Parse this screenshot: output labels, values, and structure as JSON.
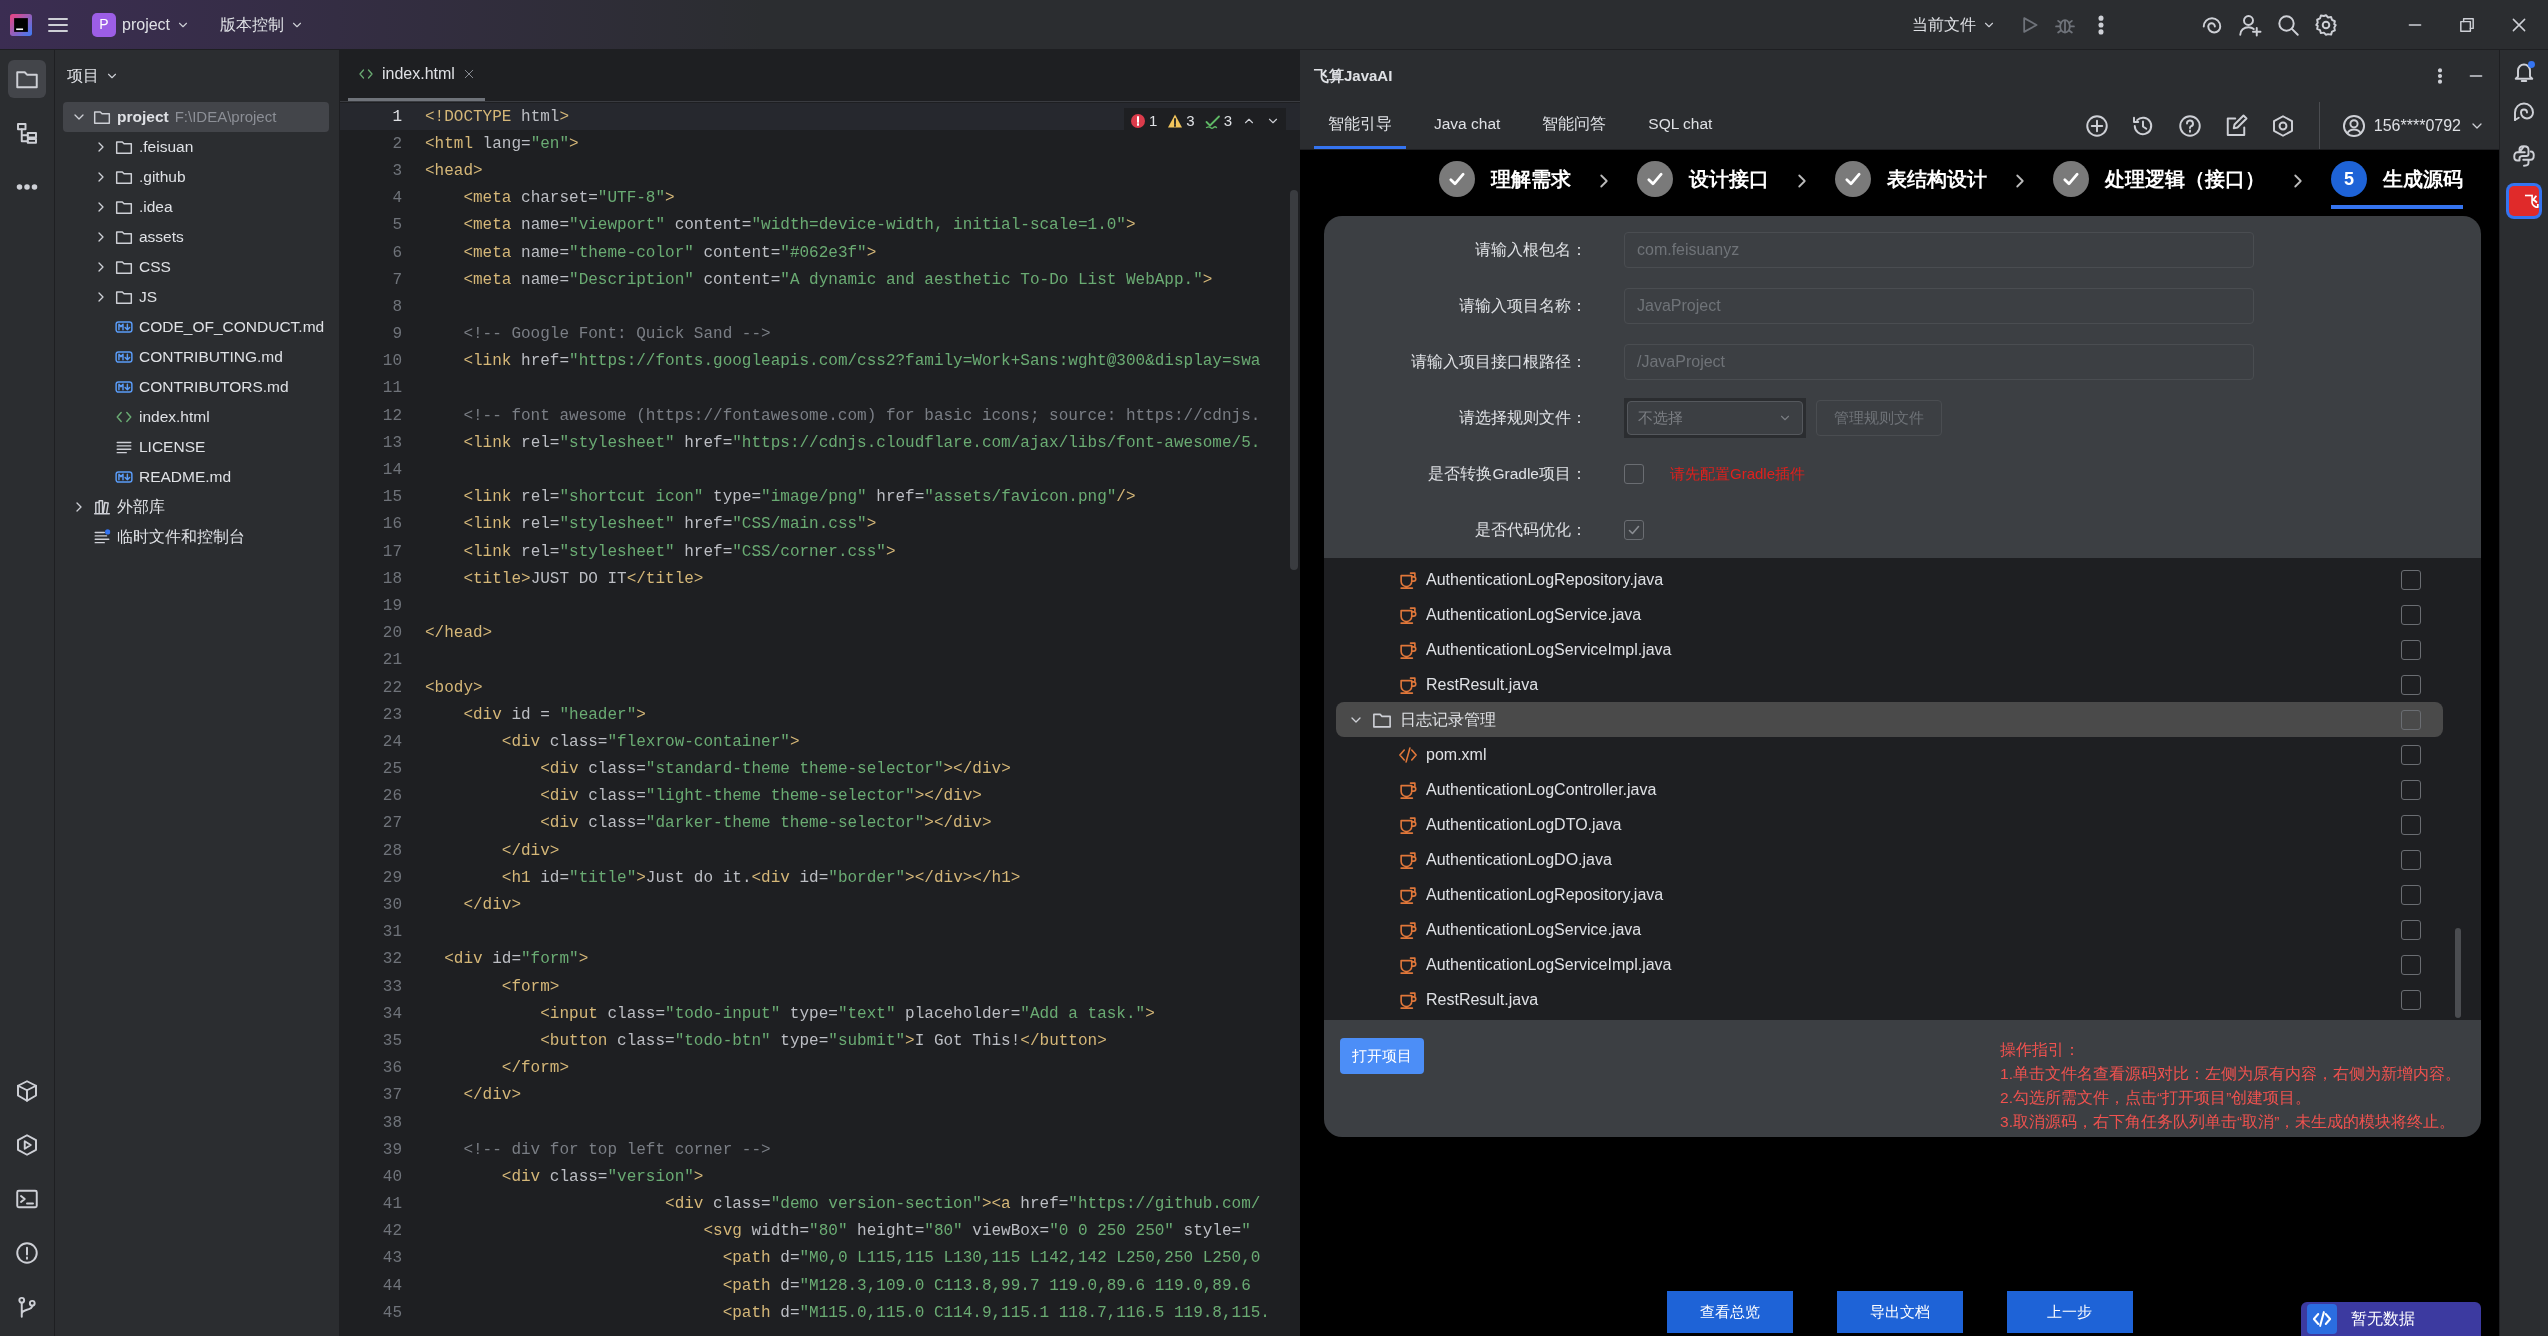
{
  "title_bar": {
    "project_initial": "P",
    "project_name": "project",
    "vcs": "版本控制",
    "run_config": "当前文件"
  },
  "project_panel": {
    "title": "项目",
    "tree": [
      {
        "label": "project",
        "path": "F:\\IDEA\\project",
        "kind": "project",
        "expanded": true,
        "selected": true,
        "children": [
          {
            "label": ".feisuan",
            "kind": "folder",
            "expanded": false,
            "selected": false
          },
          {
            "label": ".github",
            "kind": "folder",
            "expanded": false,
            "selected": false
          },
          {
            "label": ".idea",
            "kind": "folder",
            "expanded": false,
            "selected": false
          },
          {
            "label": "assets",
            "kind": "folder",
            "expanded": false,
            "selected": false
          },
          {
            "label": "CSS",
            "kind": "folder",
            "expanded": false,
            "selected": false
          },
          {
            "label": "JS",
            "kind": "folder",
            "expanded": false,
            "selected": false
          },
          {
            "label": "CODE_OF_CONDUCT.md",
            "kind": "markdown",
            "selected": false
          },
          {
            "label": "CONTRIBUTING.md",
            "kind": "markdown",
            "selected": false
          },
          {
            "label": "CONTRIBUTORS.md",
            "kind": "markdown",
            "selected": false
          },
          {
            "label": "index.html",
            "kind": "html",
            "selected": false
          },
          {
            "label": "LICENSE",
            "kind": "text",
            "selected": false
          },
          {
            "label": "README.md",
            "kind": "markdown",
            "selected": false
          }
        ]
      },
      {
        "label": "外部库",
        "kind": "library",
        "expanded": false,
        "selected": false
      },
      {
        "label": "临时文件和控制台",
        "kind": "scratch",
        "selected": false
      }
    ]
  },
  "editor": {
    "tabs": [
      {
        "label": "index.html",
        "selected": true
      }
    ],
    "inspections": {
      "errors": "1",
      "warnings": "3",
      "checks": "3"
    },
    "lines": [
      {
        "number": "1",
        "code": "<!DOCTYPE html>",
        "current": true
      },
      {
        "number": "2",
        "code": "<html lang=\"en\">",
        "current": false
      },
      {
        "number": "3",
        "code": "<head>",
        "current": false
      },
      {
        "number": "4",
        "code": "    <meta charset=\"UTF-8\">",
        "current": false
      },
      {
        "number": "5",
        "code": "    <meta name=\"viewport\" content=\"width=device-width, initial-scale=1.0\">",
        "current": false
      },
      {
        "number": "6",
        "code": "    <meta name=\"theme-color\" content=\"#062e3f\">",
        "current": false
      },
      {
        "number": "7",
        "code": "    <meta name=\"Description\" content=\"A dynamic and aesthetic To-Do List WebApp.\">",
        "current": false
      },
      {
        "number": "8",
        "current": false
      },
      {
        "number": "9",
        "code": "    <!-- Google Font: Quick Sand -->",
        "kind": "comment",
        "current": false
      },
      {
        "number": "10",
        "code": "    <link href=\"https://fonts.googleapis.com/css2?family=Work+Sans:wght@300&display=swa",
        "current": false
      },
      {
        "number": "11",
        "current": false
      },
      {
        "number": "12",
        "code": "    <!-- font awesome (https://fontawesome.com) for basic icons; source: https://cdnjs.",
        "kind": "comment",
        "current": false
      },
      {
        "number": "13",
        "code": "    <link rel=\"stylesheet\" href=\"https://cdnjs.cloudflare.com/ajax/libs/font-awesome/5.",
        "current": false
      },
      {
        "number": "14",
        "current": false
      },
      {
        "number": "15",
        "code": "    <link rel=\"shortcut icon\" type=\"image/png\" href=\"assets/favicon.png\"/>",
        "current": false
      },
      {
        "number": "16",
        "code": "    <link rel=\"stylesheet\" href=\"CSS/main.css\">",
        "current": false
      },
      {
        "number": "17",
        "code": "    <link rel=\"stylesheet\" href=\"CSS/corner.css\">",
        "current": false
      },
      {
        "number": "18",
        "code": "    <title>JUST DO IT</title>",
        "current": false
      },
      {
        "number": "19",
        "current": false
      },
      {
        "number": "20",
        "code": "</head>",
        "current": false
      },
      {
        "number": "21",
        "current": false
      },
      {
        "number": "22",
        "code": "<body>",
        "current": false
      },
      {
        "number": "23",
        "code": "    <div id = \"header\">",
        "current": false
      },
      {
        "number": "24",
        "code": "        <div class=\"flexrow-container\">",
        "current": false
      },
      {
        "number": "25",
        "code": "            <div class=\"standard-theme theme-selector\"></div>",
        "current": false
      },
      {
        "number": "26",
        "code": "            <div class=\"light-theme theme-selector\"></div>",
        "current": false
      },
      {
        "number": "27",
        "code": "            <div class=\"darker-theme theme-selector\"></div>",
        "current": false
      },
      {
        "number": "28",
        "code": "        </div>",
        "current": false
      },
      {
        "number": "29",
        "code": "        <h1 id=\"title\">Just do it.<div id=\"border\"></div></h1>",
        "current": false
      },
      {
        "number": "30",
        "code": "    </div>",
        "current": false
      },
      {
        "number": "31",
        "current": false
      },
      {
        "number": "32",
        "code": "  <div id=\"form\">",
        "current": false
      },
      {
        "number": "33",
        "code": "        <form>",
        "current": false
      },
      {
        "number": "34",
        "code": "            <input class=\"todo-input\" type=\"text\" placeholder=\"Add a task.\">",
        "current": false
      },
      {
        "number": "35",
        "code": "            <button class=\"todo-btn\" type=\"submit\">I Got This!</button>",
        "current": false
      },
      {
        "number": "36",
        "code": "        </form>",
        "current": false
      },
      {
        "number": "37",
        "code": "    </div>",
        "current": false
      },
      {
        "number": "38",
        "current": false
      },
      {
        "number": "39",
        "code": "    <!-- div for top left corner -->",
        "kind": "comment",
        "current": false
      },
      {
        "number": "40",
        "code": "        <div class=\"version\">",
        "current": false
      },
      {
        "number": "41",
        "code": "                         <div class=\"demo version-section\"><a href=\"https://github.com/",
        "current": false
      },
      {
        "number": "42",
        "code": "                             <svg width=\"80\" height=\"80\" viewBox=\"0 0 250 250\" style=\"",
        "current": false
      },
      {
        "number": "43",
        "code": "                               <path d=\"M0,0 L115,115 L130,115 L142,142 L250,250 L250,0",
        "current": false
      },
      {
        "number": "44",
        "code": "                               <path d=\"M128.3,109.0 C113.8,99.7 119.0,89.6 119.0,89.6",
        "current": false
      },
      {
        "number": "45",
        "code": "                               <path d=\"M115.0,115.0 C114.9,115.1 118.7,116.5 119.8,115.",
        "current": false
      }
    ]
  },
  "ai_panel": {
    "title": "飞算JavaAI",
    "tabs": [
      {
        "label": "智能引导",
        "selected": true
      },
      {
        "label": "Java chat",
        "selected": false
      },
      {
        "label": "智能问答",
        "selected": false
      },
      {
        "label": "SQL chat",
        "selected": false
      }
    ],
    "user": "156****0792",
    "steps": [
      {
        "label": "理解需求",
        "kind": "done"
      },
      {
        "label": "设计接口",
        "kind": "done"
      },
      {
        "label": "表结构设计",
        "kind": "done"
      },
      {
        "label": "处理逻辑（接口）",
        "kind": "done"
      },
      {
        "label": "生成源码",
        "kind": "current",
        "number": "5"
      }
    ],
    "form": [
      {
        "label": "请输入根包名：",
        "kind": "text",
        "placeholder": "com.feisuanyz"
      },
      {
        "label": "请输入项目名称：",
        "kind": "text",
        "placeholder": "JavaProject"
      },
      {
        "label": "请输入项目接口根路径：",
        "kind": "text",
        "placeholder": "/JavaProject"
      },
      {
        "label": "请选择规则文件：",
        "kind": "select",
        "value": "不选择",
        "button": "管理规则文件"
      },
      {
        "label": "是否转换Gradle项目：",
        "kind": "checkbox",
        "checked": false,
        "note": "请先配置Gradle插件"
      },
      {
        "label": "是否代码优化：",
        "kind": "checkbox",
        "checked": true
      }
    ],
    "files": [
      {
        "name": "AuthenticationLogRepository.java",
        "kind": "java",
        "checked": false
      },
      {
        "name": "AuthenticationLogService.java",
        "kind": "java",
        "checked": false
      },
      {
        "name": "AuthenticationLogServiceImpl.java",
        "kind": "java",
        "checked": false
      },
      {
        "name": "RestResult.java",
        "kind": "java",
        "checked": false
      },
      {
        "name": "日志记录管理",
        "kind": "folder",
        "expanded": true,
        "checked": false,
        "children": [
          {
            "name": "pom.xml",
            "kind": "xml",
            "checked": false
          },
          {
            "name": "AuthenticationLogController.java",
            "kind": "java",
            "checked": false
          },
          {
            "name": "AuthenticationLogDTO.java",
            "kind": "java",
            "checked": false
          },
          {
            "name": "AuthenticationLogDO.java",
            "kind": "java",
            "checked": false
          },
          {
            "name": "AuthenticationLogRepository.java",
            "kind": "java",
            "checked": false
          },
          {
            "name": "AuthenticationLogService.java",
            "kind": "java",
            "checked": false
          },
          {
            "name": "AuthenticationLogServiceImpl.java",
            "kind": "java",
            "checked": false
          },
          {
            "name": "RestResult.java",
            "kind": "java",
            "checked": false
          }
        ]
      }
    ],
    "open_button": "打开项目",
    "guide": {
      "title": "操作指引：",
      "lines": [
        "1.单击文件名查看源码对比：左侧为原有内容，右侧为新增内容。",
        "2.勾选所需文件，点击“打开项目”创建项目。",
        "3.取消源码，右下角任务队列单击“取消”，未生成的模块将终止。"
      ]
    },
    "buttons": [
      "查看总览",
      "导出文档",
      "上一步"
    ],
    "task_widget": "暂无数据"
  },
  "right_strip": {
    "badge": "飞"
  }
}
